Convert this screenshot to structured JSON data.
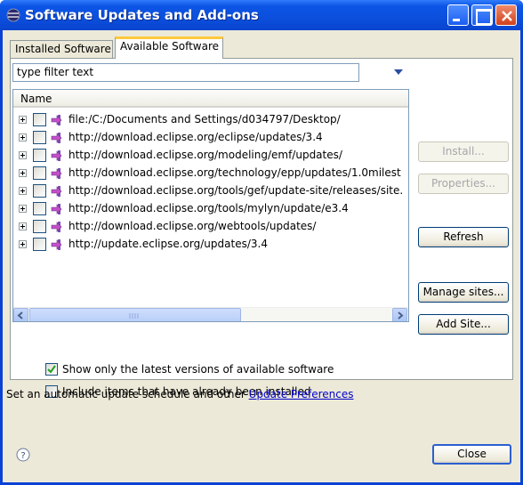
{
  "window": {
    "title": "Software Updates and Add-ons"
  },
  "tabs": [
    {
      "label": "Installed Software"
    },
    {
      "label": "Available Software"
    }
  ],
  "filter": {
    "placeholder": "type filter text"
  },
  "tree": {
    "column_header": "Name",
    "rows": [
      {
        "label": "file:/C:/Documents and Settings/d034797/Desktop/"
      },
      {
        "label": "http://download.eclipse.org/eclipse/updates/3.4"
      },
      {
        "label": "http://download.eclipse.org/modeling/emf/updates/"
      },
      {
        "label": "http://download.eclipse.org/technology/epp/updates/1.0milest"
      },
      {
        "label": "http://download.eclipse.org/tools/gef/update-site/releases/site."
      },
      {
        "label": "http://download.eclipse.org/tools/mylyn/update/e3.4"
      },
      {
        "label": "http://download.eclipse.org/webtools/updates/"
      },
      {
        "label": "http://update.eclipse.org/updates/3.4"
      }
    ]
  },
  "buttons": {
    "install": "Install...",
    "properties": "Properties...",
    "refresh": "Refresh",
    "manage_sites": "Manage sites...",
    "add_site": "Add Site...",
    "close": "Close"
  },
  "options": {
    "show_latest": {
      "label": "Show only the latest versions of available software",
      "checked": true
    },
    "include_installed": {
      "label": "Include items that have already been installed",
      "checked": false
    }
  },
  "preferences": {
    "text": "Set an automatic update schedule and other ",
    "link": "Update Preferences"
  },
  "colors": {
    "titlebar": "#0a4ee0",
    "dialog_bg": "#ece9d8",
    "link": "#0000cc",
    "active_tab_accent": "#ffc83c"
  }
}
